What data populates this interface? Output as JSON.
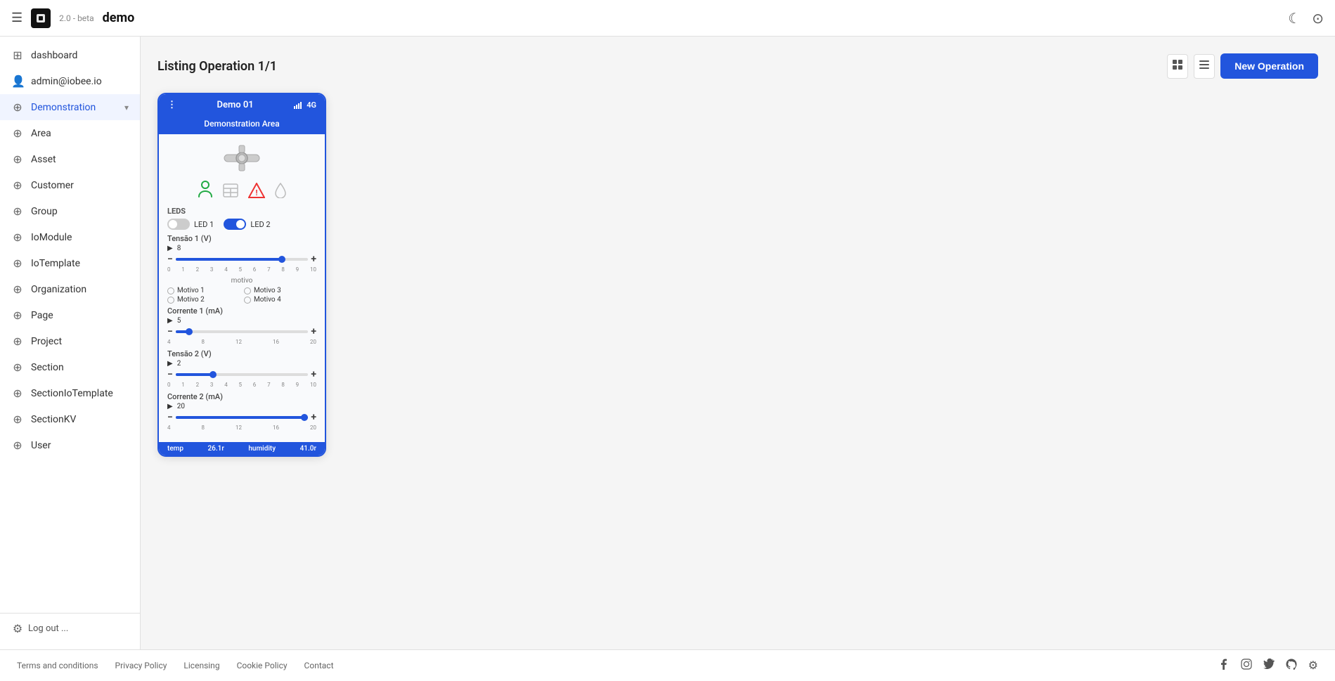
{
  "topbar": {
    "menu_icon": "☰",
    "version": "2.0 - beta",
    "appname": "demo",
    "dark_mode_icon": "☾",
    "user_icon": "⊙"
  },
  "sidebar": {
    "items": [
      {
        "id": "dashboard",
        "label": "dashboard",
        "icon": "⊞"
      },
      {
        "id": "admin",
        "label": "admin@iobee.io",
        "icon": "👤"
      },
      {
        "id": "demonstration",
        "label": "Demonstration",
        "icon": "⊕",
        "chevron": "▾",
        "active": true
      },
      {
        "id": "area",
        "label": "Area",
        "icon": "⊕"
      },
      {
        "id": "asset",
        "label": "Asset",
        "icon": "⊕"
      },
      {
        "id": "customer",
        "label": "Customer",
        "icon": "⊕"
      },
      {
        "id": "group",
        "label": "Group",
        "icon": "⊕"
      },
      {
        "id": "iomodule",
        "label": "IoModule",
        "icon": "⊕"
      },
      {
        "id": "iotemplate",
        "label": "IoTemplate",
        "icon": "⊕"
      },
      {
        "id": "organization",
        "label": "Organization",
        "icon": "⊕"
      },
      {
        "id": "page",
        "label": "Page",
        "icon": "⊕"
      },
      {
        "id": "project",
        "label": "Project",
        "icon": "⊕"
      },
      {
        "id": "section",
        "label": "Section",
        "icon": "⊕"
      },
      {
        "id": "sectioniotemplate",
        "label": "SectionIoTemplate",
        "icon": "⊕"
      },
      {
        "id": "sectionkv",
        "label": "SectionKV",
        "icon": "⊕"
      },
      {
        "id": "user",
        "label": "User",
        "icon": "⊕"
      }
    ],
    "bottom": {
      "settings_icon": "⚙",
      "logout_label": "Log out ..."
    }
  },
  "content": {
    "title": "Listing Operation 1/1",
    "grid_icon": "⊞",
    "list_icon": "☰",
    "new_button_label": "New Operation"
  },
  "device_card": {
    "header_dots": "⋮",
    "device_name": "Demo 01",
    "signal_icon": "▐▐▐",
    "network": "4G",
    "subheader": "Demonstration Area",
    "icons": [
      {
        "id": "person",
        "symbol": "👤",
        "color": "green"
      },
      {
        "id": "table",
        "symbol": "⊞",
        "color": "gray"
      },
      {
        "id": "warning",
        "symbol": "⚠",
        "color": "orange-red"
      },
      {
        "id": "drop",
        "symbol": "💧",
        "color": "gray"
      }
    ],
    "leds_label": "LEDS",
    "led1_label": "LED 1",
    "led1_state": "off",
    "led2_label": "LED 2",
    "led2_state": "on",
    "sliders": [
      {
        "id": "tensao1",
        "title": "Tensão 1 (V)",
        "value": 8,
        "min": 0,
        "max": 10,
        "fill_pct": 80,
        "thumb_pct": 80,
        "marks": [
          "0",
          "1",
          "2",
          "3",
          "4",
          "5",
          "6",
          "7",
          "8",
          "9",
          "10"
        ]
      },
      {
        "id": "corrente1",
        "title": "Corrente 1 (mA)",
        "value": 5,
        "min": 4,
        "max": 20,
        "fill_pct": 10,
        "thumb_pct": 10,
        "marks": [
          "4",
          "8",
          "12",
          "16",
          "20"
        ]
      },
      {
        "id": "tensao2",
        "title": "Tensão 2 (V)",
        "value": 2,
        "min": 0,
        "max": 10,
        "fill_pct": 28,
        "thumb_pct": 28,
        "marks": [
          "0",
          "1",
          "2",
          "3",
          "4",
          "5",
          "6",
          "7",
          "8",
          "9",
          "10"
        ]
      },
      {
        "id": "corrente2",
        "title": "Corrente 2 (mA)",
        "value": 20,
        "min": 4,
        "max": 20,
        "fill_pct": 100,
        "thumb_pct": 100,
        "marks": [
          "4",
          "8",
          "12",
          "16",
          "20"
        ]
      }
    ],
    "motivo_title": "motivo",
    "motivo_options": [
      "Motivo 1",
      "Motivo 2",
      "Motivo 3",
      "Motivo 4"
    ],
    "bottom_items": [
      {
        "id": "temp",
        "label": "temp",
        "value": "26.1r"
      },
      {
        "id": "humidity",
        "label": "humidity",
        "value": "41.0r"
      }
    ]
  },
  "footer": {
    "links": [
      "Terms and conditions",
      "Privacy Policy",
      "Licensing",
      "Cookie Policy",
      "Contact"
    ],
    "social_icons": [
      "f",
      "in",
      "t",
      "gh",
      "⊙"
    ]
  }
}
